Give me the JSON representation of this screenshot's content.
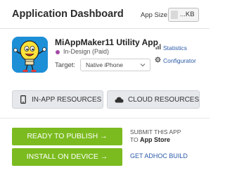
{
  "header": {
    "title": "Application Dashboard",
    "app_size_label": "App Size:",
    "app_size_value": "...KB"
  },
  "app": {
    "name": "MiAppMaker11 Utility App",
    "status": "In-Design (Paid)",
    "status_color": "#a44aa7",
    "icon_color": "#1d8fd6",
    "target_label": "Target:",
    "target_value": "Native iPhone"
  },
  "links": {
    "statistics": "Statistics",
    "configurator": "Configurator"
  },
  "resources": {
    "in_app": "IN-APP RESOURCES",
    "cloud": "CLOUD RESOURCES"
  },
  "actions": {
    "ready_to_publish": "READY TO PUBLISH →",
    "install_on_device": "INSTALL ON DEVICE →",
    "accent_color": "#7bbb1f",
    "submit_line1": "SUBMIT THIS APP",
    "submit_line2_prefix": "TO",
    "submit_store": "App Store",
    "adhoc": "GET ADHOC BUILD"
  }
}
